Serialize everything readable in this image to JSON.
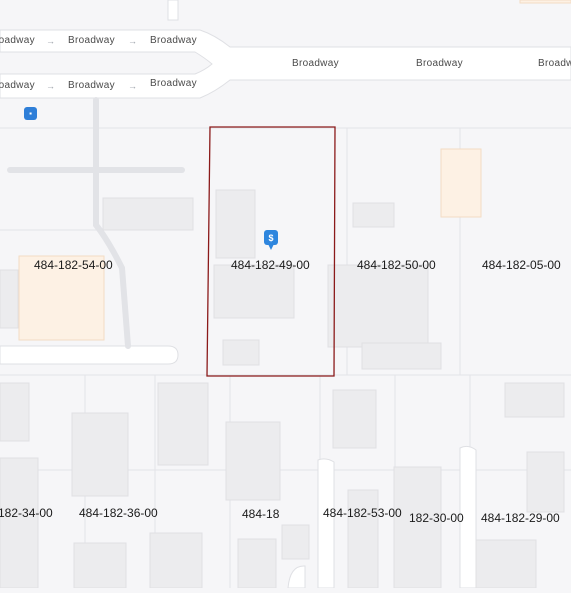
{
  "map": {
    "road_name": "Broadway",
    "road_labels_top": [
      "Broadway",
      "Broadway",
      "Broadway"
    ],
    "road_labels_bottom": [
      "Broadway",
      "Broadway",
      "Broadway"
    ],
    "road_labels_main": [
      "Broadway",
      "Broadway",
      "Broadway"
    ],
    "arrow_glyph": "→",
    "transit_icon": "bus-stop-icon",
    "marker_icon": "dollar-marker-icon",
    "marker_glyph": "$",
    "highlight_color": "#8b1a1a",
    "parcels_row1": [
      "484-182-54-00",
      "484-182-49-00",
      "484-182-50-00",
      "484-182-05-00"
    ],
    "parcels_row2": [
      "182-34-00",
      "484-182-36-00",
      "484-18",
      "484-182-53-00",
      "182-30-00",
      "484-182-29-00"
    ]
  }
}
